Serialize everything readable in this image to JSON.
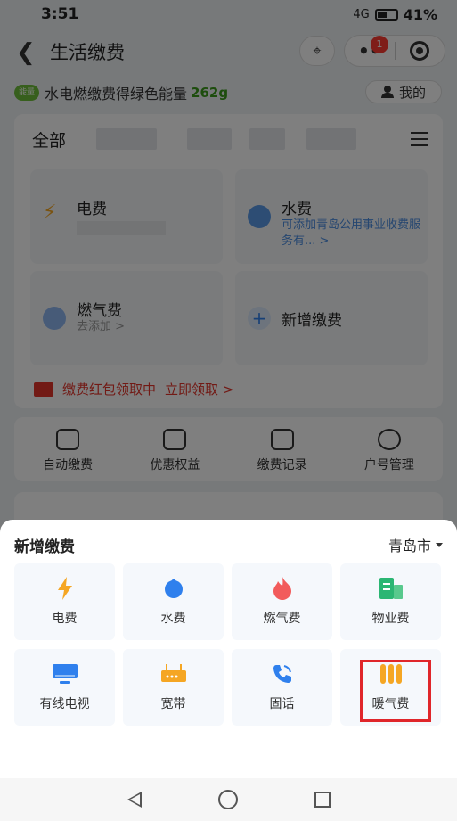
{
  "status_bar": {
    "time": "3:51",
    "network": "4G",
    "battery": "41%"
  },
  "nav": {
    "title": "生活缴费",
    "badge_count": "1"
  },
  "energy": {
    "tag": "能量",
    "text": "水电燃缴费得绿色能量",
    "amount": "262g",
    "mine_label": "我的"
  },
  "bills": {
    "tab_all": "全部",
    "cards": [
      {
        "title": "电费",
        "subtitle": ""
      },
      {
        "title": "水费",
        "subtitle": "可添加青岛公用事业收费服务有... >"
      },
      {
        "title": "燃气费",
        "subtitle": "去添加 >"
      },
      {
        "title": "新增缴费",
        "subtitle": ""
      }
    ],
    "promo_text": "缴费红包领取中",
    "promo_link": "立即领取 >"
  },
  "quick_actions": [
    {
      "label": "自动缴费"
    },
    {
      "label": "优惠权益"
    },
    {
      "label": "缴费记录"
    },
    {
      "label": "户号管理"
    }
  ],
  "sheet": {
    "title": "新增缴费",
    "city": "青岛市",
    "services": [
      {
        "label": "电费",
        "icon": "lightning-icon",
        "color": "#f5a623"
      },
      {
        "label": "水费",
        "icon": "water-drop-icon",
        "color": "#2f80ed"
      },
      {
        "label": "燃气费",
        "icon": "flame-icon",
        "color": "#f25b5b"
      },
      {
        "label": "物业费",
        "icon": "building-icon",
        "color": "#2bb673"
      },
      {
        "label": "有线电视",
        "icon": "tv-icon",
        "color": "#2f80ed"
      },
      {
        "label": "宽带",
        "icon": "router-icon",
        "color": "#f5a623"
      },
      {
        "label": "固话",
        "icon": "phone-icon",
        "color": "#2f80ed"
      },
      {
        "label": "暖气费",
        "icon": "radiator-icon",
        "color": "#f5a623"
      }
    ]
  }
}
